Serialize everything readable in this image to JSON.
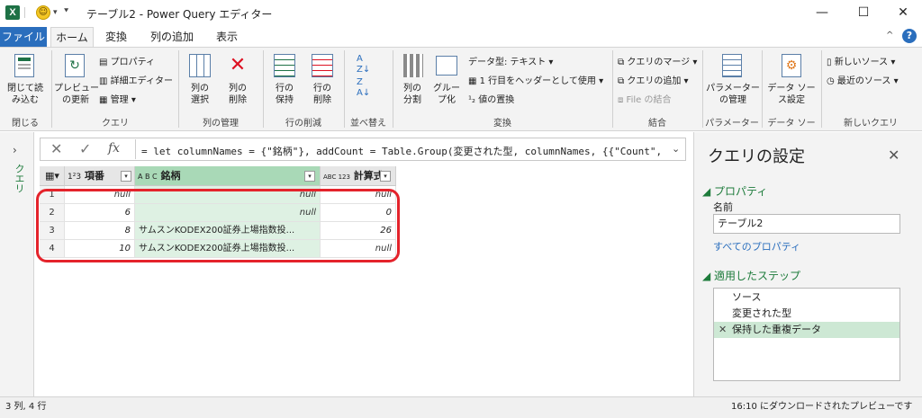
{
  "window": {
    "title": "テーブル2 - Power Query エディター",
    "app_icon": "X",
    "colors": {
      "accent": "#2a6ebd",
      "excel_green": "#1e7145",
      "highlight": "#e4232b"
    }
  },
  "tabs": [
    "ファイル",
    "ホーム",
    "変換",
    "列の追加",
    "表示"
  ],
  "ribbon": {
    "close_group": {
      "btn": "閉じて読\nみ込む",
      "label": "閉じる"
    },
    "query_group": {
      "preview": "プレビュー\nの更新",
      "properties": "プロパティ",
      "advanced": "詳細エディター",
      "manage": "管理",
      "label": "クエリ"
    },
    "columns_group": {
      "select": "列の\n選択",
      "delete": "列の\n削除",
      "label": "列の管理"
    },
    "rows_group": {
      "keep": "行の\n保持",
      "remove": "行の\n削除",
      "label": "行の削減"
    },
    "sort_group": {
      "label": "並べ替え"
    },
    "transform_group": {
      "split": "列の\n分割",
      "groupby": "グルー\nプ化",
      "datatype": "データ型: テキスト",
      "firstrow": "1 行目をヘッダーとして使用",
      "replace": "値の置換",
      "label": "変換"
    },
    "combine_group": {
      "merge": "クエリのマージ",
      "append": "クエリの追加",
      "files": "File の結合",
      "label": "結合"
    },
    "params_group": {
      "btn": "パラメーター\nの管理",
      "label": "パラメーター"
    },
    "datasource_group": {
      "btn": "データ ソー\nス設定",
      "label": "データ ソース"
    },
    "newquery_group": {
      "new_source": "新しいソース",
      "recent": "最近のソース",
      "label": "新しいクエリ"
    }
  },
  "left_pane": {
    "label": "クエリ"
  },
  "formula_bar": {
    "fx": "fx",
    "text": "= let columnNames = {\"銘柄\"}, addCount = Table.Group(変更された型, columnNames, {{\"Count\","
  },
  "grid": {
    "columns": [
      {
        "type": "1²3",
        "name": "項番"
      },
      {
        "type": "A B C",
        "name": "銘柄"
      },
      {
        "type": "ABC 123",
        "name": "計算式"
      }
    ],
    "rows": [
      {
        "no": "1",
        "c1": "null",
        "c2": "null",
        "c3": "null"
      },
      {
        "no": "2",
        "c1": "6",
        "c2": "null",
        "c3": "0"
      },
      {
        "no": "3",
        "c1": "8",
        "c2": "サムスンKODEX200証券上場指数投...",
        "c3": "26"
      },
      {
        "no": "4",
        "c1": "10",
        "c2": "サムスンKODEX200証券上場指数投...",
        "c3": "null"
      }
    ]
  },
  "settings": {
    "title": "クエリの設定",
    "properties_section": "プロパティ",
    "name_label": "名前",
    "name_value": "テーブル2",
    "all_props_link": "すべてのプロパティ",
    "steps_section": "適用したステップ",
    "steps": [
      "ソース",
      "変更された型",
      "保持した重複データ"
    ],
    "selected_step_index": 2
  },
  "status": {
    "left": "3 列, 4 行",
    "right": "16:10 にダウンロードされたプレビューです"
  }
}
